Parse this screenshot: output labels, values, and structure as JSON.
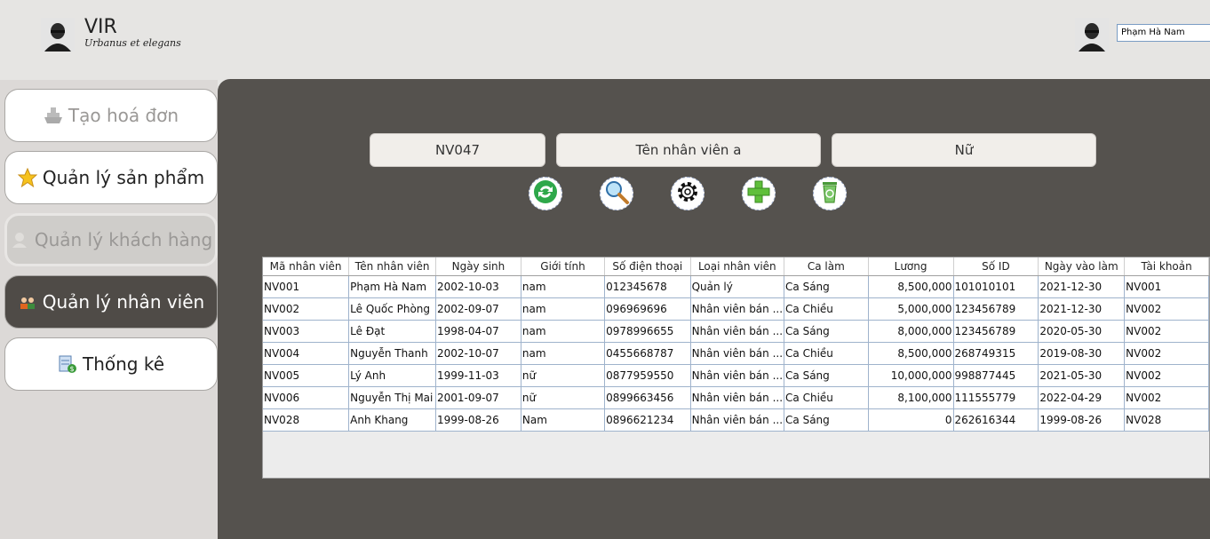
{
  "brand": {
    "title": "VIR",
    "subtitle": "Urbanus et elegans"
  },
  "user": {
    "selected": "Phạm Hà Nam"
  },
  "sidebar": {
    "items": [
      {
        "label": "Tạo hoá đơn",
        "icon": "ship-icon",
        "state": "disabled"
      },
      {
        "label": "Quản lý sản phẩm",
        "icon": "star-icon",
        "state": "normal"
      },
      {
        "label": "Quản lý khách hàng",
        "icon": "person-icon",
        "state": "disabled"
      },
      {
        "label": "Quản lý nhân viên",
        "icon": "staff-icon",
        "state": "active"
      },
      {
        "label": "Thống kê",
        "icon": "report-icon",
        "state": "normal"
      }
    ]
  },
  "form": {
    "id_value": "NV047",
    "name_value": "Tên nhân viên a",
    "gender_value": "Nữ"
  },
  "toolbar": [
    "refresh-icon",
    "search-icon",
    "settings-icon",
    "add-icon",
    "delete-icon"
  ],
  "table": {
    "columns": [
      "Mã nhân viên",
      "Tên nhân viên",
      "Ngày sinh",
      "Giới tính",
      "Số điện thoại",
      "Loại nhân viên",
      "Ca làm",
      "Lương",
      "Số ID",
      "Ngày vào làm",
      "Tài khoản"
    ],
    "rows": [
      [
        "NV001",
        "Phạm Hà Nam",
        "2002-10-03",
        "nam",
        "012345678",
        "Quản lý",
        "Ca Sáng",
        "8,500,000",
        "101010101",
        "2021-12-30",
        "NV001"
      ],
      [
        "NV002",
        "Lê Quốc Phòng",
        "2002-09-07",
        "nam",
        "096969696",
        "Nhân viên bán ...",
        "Ca Chiều",
        "5,000,000",
        "123456789",
        "2021-12-30",
        "NV002"
      ],
      [
        "NV003",
        "Lê Đạt",
        "1998-04-07",
        "nam",
        "0978996655",
        "Nhân viên bán ...",
        "Ca Sáng",
        "8,000,000",
        "123456789",
        "2020-05-30",
        "NV002"
      ],
      [
        "NV004",
        "Nguyễn Thanh",
        "2002-10-07",
        "nam",
        "0455668787",
        "Nhân viên bán ...",
        "Ca Chiều",
        "8,500,000",
        "268749315",
        "2019-08-30",
        "NV002"
      ],
      [
        "NV005",
        "Lý Anh",
        "1999-11-03",
        "nữ",
        "0877959550",
        "Nhân viên bán ...",
        "Ca Sáng",
        "10,000,000",
        "998877445",
        "2021-05-30",
        "NV002"
      ],
      [
        "NV006",
        "Nguyễn Thị Mai",
        "2001-09-07",
        "nữ",
        "0899663456",
        "Nhân viên bán ...",
        "Ca Chiều",
        "8,100,000",
        "111555779",
        "2022-04-29",
        "NV002"
      ],
      [
        "NV028",
        "Anh Khang",
        "1999-08-26",
        "Nam",
        "0896621234",
        "Nhân viên bán ...",
        "Ca Sáng",
        "0",
        "262616344",
        "1999-08-26",
        "NV028"
      ]
    ]
  },
  "colors": {
    "panel": "#55524e",
    "active_nav": "#4f4b47",
    "sidebar": "#dcd9d7",
    "header": "#e6e5e3"
  }
}
